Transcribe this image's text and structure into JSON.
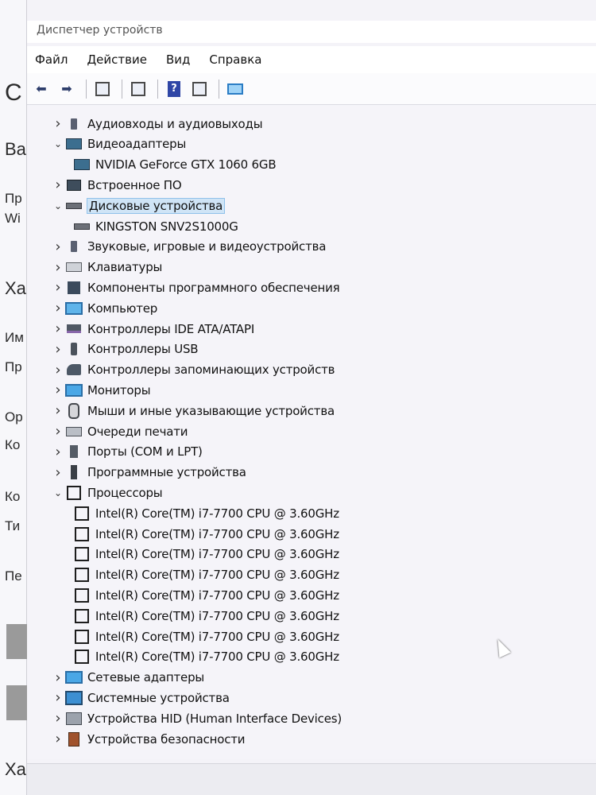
{
  "window": {
    "title": "Диспетчер устройств"
  },
  "menu": [
    "Файл",
    "Действие",
    "Вид",
    "Справка"
  ],
  "background_window": {
    "letters": [
      "С",
      "Ва",
      "Пр",
      "Wi",
      "Ха",
      "Им",
      "Пр",
      "Ор",
      "Ко",
      "Ко",
      "Ти",
      "Пе",
      "Ха"
    ]
  },
  "tree": [
    {
      "label": "Аудиовходы и аудиовыходы",
      "level": 0,
      "expanded": false,
      "icon": "speaker-icon"
    },
    {
      "label": "Видеоадаптеры",
      "level": 0,
      "expanded": true,
      "icon": "display-adapter-icon"
    },
    {
      "label": "NVIDIA GeForce GTX 1060 6GB",
      "level": 1,
      "icon": "display-adapter-icon"
    },
    {
      "label": "Встроенное ПО",
      "level": 0,
      "expanded": false,
      "icon": "firmware-icon"
    },
    {
      "label": "Дисковые устройства",
      "level": 0,
      "expanded": true,
      "selected": true,
      "icon": "disk-drive-icon"
    },
    {
      "label": "KINGSTON SNV2S1000G",
      "level": 1,
      "icon": "disk-drive-icon"
    },
    {
      "label": "Звуковые, игровые и видеоустройства",
      "level": 0,
      "expanded": false,
      "icon": "sound-icon"
    },
    {
      "label": "Клавиатуры",
      "level": 0,
      "expanded": false,
      "icon": "keyboard-icon"
    },
    {
      "label": "Компоненты программного обеспечения",
      "level": 0,
      "expanded": false,
      "icon": "software-component-icon"
    },
    {
      "label": "Компьютер",
      "level": 0,
      "expanded": false,
      "icon": "computer-icon"
    },
    {
      "label": "Контроллеры IDE ATA/ATAPI",
      "level": 0,
      "expanded": false,
      "icon": "ide-controller-icon"
    },
    {
      "label": "Контроллеры USB",
      "level": 0,
      "expanded": false,
      "icon": "usb-icon"
    },
    {
      "label": "Контроллеры запоминающих устройств",
      "level": 0,
      "expanded": false,
      "icon": "storage-controller-icon"
    },
    {
      "label": "Мониторы",
      "level": 0,
      "expanded": false,
      "icon": "monitor-icon"
    },
    {
      "label": "Мыши и иные указывающие устройства",
      "level": 0,
      "expanded": false,
      "icon": "mouse-icon"
    },
    {
      "label": "Очереди печати",
      "level": 0,
      "expanded": false,
      "icon": "printer-icon"
    },
    {
      "label": "Порты (COM и LPT)",
      "level": 0,
      "expanded": false,
      "icon": "port-icon"
    },
    {
      "label": "Программные устройства",
      "level": 0,
      "expanded": false,
      "icon": "software-device-icon"
    },
    {
      "label": "Процессоры",
      "level": 0,
      "expanded": true,
      "icon": "processor-icon"
    },
    {
      "label": "Intel(R) Core(TM) i7-7700 CPU @ 3.60GHz",
      "level": 1,
      "icon": "processor-icon"
    },
    {
      "label": "Intel(R) Core(TM) i7-7700 CPU @ 3.60GHz",
      "level": 1,
      "icon": "processor-icon"
    },
    {
      "label": "Intel(R) Core(TM) i7-7700 CPU @ 3.60GHz",
      "level": 1,
      "icon": "processor-icon"
    },
    {
      "label": "Intel(R) Core(TM) i7-7700 CPU @ 3.60GHz",
      "level": 1,
      "icon": "processor-icon"
    },
    {
      "label": "Intel(R) Core(TM) i7-7700 CPU @ 3.60GHz",
      "level": 1,
      "icon": "processor-icon"
    },
    {
      "label": "Intel(R) Core(TM) i7-7700 CPU @ 3.60GHz",
      "level": 1,
      "icon": "processor-icon"
    },
    {
      "label": "Intel(R) Core(TM) i7-7700 CPU @ 3.60GHz",
      "level": 1,
      "icon": "processor-icon"
    },
    {
      "label": "Intel(R) Core(TM) i7-7700 CPU @ 3.60GHz",
      "level": 1,
      "icon": "processor-icon"
    },
    {
      "label": "Сетевые адаптеры",
      "level": 0,
      "expanded": false,
      "icon": "network-adapter-icon"
    },
    {
      "label": "Системные устройства",
      "level": 0,
      "expanded": false,
      "icon": "system-device-icon"
    },
    {
      "label": "Устройства HID (Human Interface Devices)",
      "level": 0,
      "expanded": false,
      "icon": "hid-icon"
    },
    {
      "label": "Устройства безопасности",
      "level": 0,
      "expanded": false,
      "icon": "security-device-icon"
    }
  ]
}
